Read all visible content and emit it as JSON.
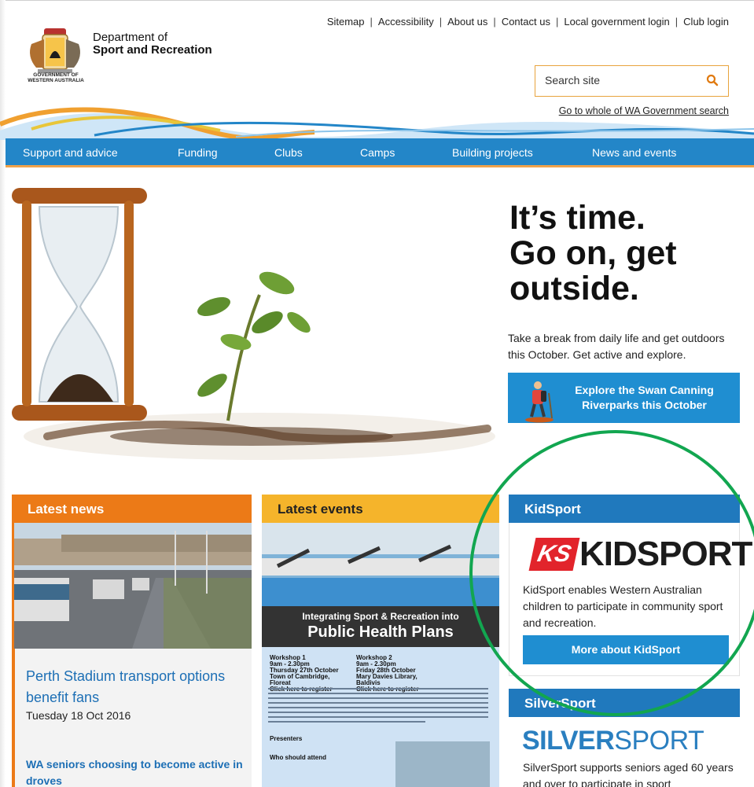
{
  "header": {
    "dept_line1": "Department of",
    "dept_line2": "Sport and Recreation",
    "gov_line1": "GOVERNMENT OF",
    "gov_line2": "WESTERN AUSTRALIA",
    "top_links": [
      "Sitemap",
      "Accessibility",
      "About us",
      "Contact us",
      "Local government login",
      "Club login"
    ],
    "search_placeholder": "Search site",
    "wa_search_link": "Go to whole of WA Government search"
  },
  "nav": {
    "items": [
      "Support and advice",
      "Funding",
      "Clubs",
      "Camps",
      "Building projects",
      "News and events"
    ]
  },
  "hero": {
    "headline_1": "It’s time.",
    "headline_2": "Go on, get",
    "headline_3": "outside.",
    "text": "Take a break from daily life and get outdoors this October. Get active and explore.",
    "button_line1": "Explore the Swan Canning",
    "button_line2": "Riverparks this October"
  },
  "news": {
    "heading": "Latest news",
    "article_title": "Perth Stadium transport options benefit fans",
    "article_date": "Tuesday 18 Oct 2016",
    "second_title": "WA seniors choosing to become active in droves"
  },
  "events": {
    "heading": "Latest events",
    "poster_line1": "Integrating Sport & Recreation into",
    "poster_line2": "Public Health Plans",
    "ws1_title": "Workshop 1",
    "ws1_time": "9am - 2.30pm",
    "ws1_date": "Thursday 27th October",
    "ws1_place": "Town of Cambridge, Floreat",
    "ws1_reg": "Click here to register",
    "ws2_title": "Workshop 2",
    "ws2_time": "9am - 2.30pm",
    "ws2_date": "Friday 28th October",
    "ws2_place": "Mary Davies Library, Baldivis",
    "ws2_reg": "Click here to register",
    "presenters_label": "Presenters",
    "who_label": "Who should attend"
  },
  "kidsport": {
    "heading": "KidSport",
    "logo_badge": "KS",
    "logo_text": "KIDSPORT",
    "text": "KidSport enables Western Australian children to participate in community sport and recreation.",
    "button": "More about KidSport"
  },
  "silversport": {
    "heading": "SilverSport",
    "logo_bold": "SILVER",
    "logo_light": "SPORT",
    "text": "SilverSport supports seniors aged 60 years and over to participate in sport"
  },
  "colors": {
    "nav_blue": "#2386c8",
    "news_orange": "#ec7a17",
    "events_yellow": "#f5b42b",
    "kidsport_blue": "#2079bd",
    "annotation_green": "#12a650"
  }
}
